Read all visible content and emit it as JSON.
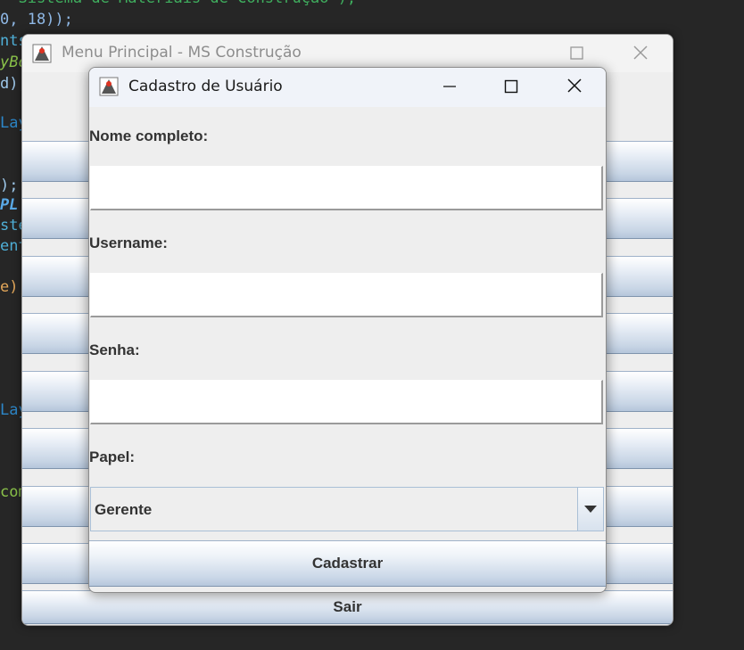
{
  "editor": {
    "lines": [
      {
        "text": "  Sistema de Materiais de Construção\");",
        "color": "#3fae5e"
      },
      {
        "text": "0, 18));",
        "color": "#8fb8e6"
      },
      {
        "text": "nts",
        "color": "#4fb0d8"
      },
      {
        "text": "yBo",
        "color": "#8bc34a"
      },
      {
        "text": "d);",
        "color": "#9ec8ea"
      },
      {
        "text": "Lay",
        "color": "#2d87c9"
      },
      {
        "text": ");",
        "color": "#9ec8ea"
      },
      {
        "text": "PL",
        "color": "#5aa9e6"
      },
      {
        "text": "ste",
        "color": "#4fb0d8"
      },
      {
        "text": "ent",
        "color": "#4fb0d8"
      },
      {
        "text": "e);",
        "color": "#e3a75a"
      },
      {
        "text": "Lay",
        "color": "#2d87c9"
      },
      {
        "text": "com",
        "color": "#8bc34a"
      }
    ]
  },
  "main_window": {
    "title": "Menu Principal - MS Construção",
    "sair_label": "Sair"
  },
  "dialog": {
    "title": "Cadastro de Usuário",
    "labels": {
      "nome": "Nome completo:",
      "username": "Username:",
      "senha": "Senha:",
      "papel": "Papel:"
    },
    "fields": {
      "nome_value": "",
      "username_value": "",
      "senha_value": ""
    },
    "papel_selected": "Gerente",
    "submit_label": "Cadastrar"
  },
  "colors": {
    "button_gradient_top": "#ffffff",
    "button_gradient_bottom": "#b5c6db",
    "panel_bg": "#eeeeee"
  }
}
